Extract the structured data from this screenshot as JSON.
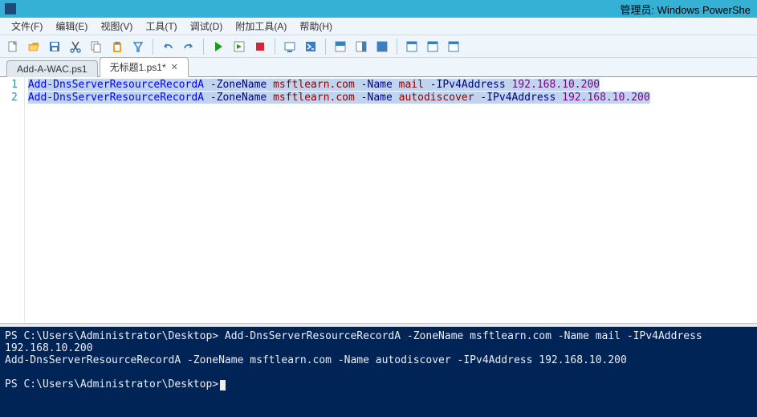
{
  "titlebar": {
    "title": "管理员: Windows PowerShe"
  },
  "menubar": {
    "items": [
      {
        "label": "文件(F)"
      },
      {
        "label": "编辑(E)"
      },
      {
        "label": "视图(V)"
      },
      {
        "label": "工具(T)"
      },
      {
        "label": "调试(D)"
      },
      {
        "label": "附加工具(A)"
      },
      {
        "label": "帮助(H)"
      }
    ]
  },
  "tabs": [
    {
      "label": "Add-A-WAC.ps1",
      "active": false,
      "closable": false
    },
    {
      "label": "无标题1.ps1*",
      "active": true,
      "closable": true
    }
  ],
  "editor": {
    "lines": [
      {
        "num": "1",
        "tokens": [
          {
            "t": "Add-DnsServerResourceRecordA",
            "cls": "tk-cmd"
          },
          {
            "t": " ",
            "cls": "tk-plain"
          },
          {
            "t": "-ZoneName",
            "cls": "tk-param"
          },
          {
            "t": " ",
            "cls": "tk-plain"
          },
          {
            "t": "msftlearn.com",
            "cls": "tk-str"
          },
          {
            "t": " ",
            "cls": "tk-plain"
          },
          {
            "t": "-Name",
            "cls": "tk-param"
          },
          {
            "t": " ",
            "cls": "tk-plain"
          },
          {
            "t": "mail",
            "cls": "tk-str"
          },
          {
            "t": " ",
            "cls": "tk-plain"
          },
          {
            "t": "-IPv4Address",
            "cls": "tk-param"
          },
          {
            "t": " ",
            "cls": "tk-plain"
          },
          {
            "t": "192.168.10.200",
            "cls": "tk-ip"
          }
        ]
      },
      {
        "num": "2",
        "tokens": [
          {
            "t": "Add-DnsServerResourceRecordA",
            "cls": "tk-cmd"
          },
          {
            "t": " ",
            "cls": "tk-plain"
          },
          {
            "t": "-ZoneName",
            "cls": "tk-param"
          },
          {
            "t": " ",
            "cls": "tk-plain"
          },
          {
            "t": "msftlearn.com",
            "cls": "tk-str"
          },
          {
            "t": " ",
            "cls": "tk-plain"
          },
          {
            "t": "-Name",
            "cls": "tk-param"
          },
          {
            "t": " ",
            "cls": "tk-plain"
          },
          {
            "t": "autodiscover",
            "cls": "tk-str"
          },
          {
            "t": " ",
            "cls": "tk-plain"
          },
          {
            "t": "-IPv4Address",
            "cls": "tk-param"
          },
          {
            "t": " ",
            "cls": "tk-plain"
          },
          {
            "t": "192.168.10.200",
            "cls": "tk-ip"
          }
        ]
      }
    ]
  },
  "console": {
    "lines": [
      "PS C:\\Users\\Administrator\\Desktop> Add-DnsServerResourceRecordA -ZoneName msftlearn.com -Name mail -IPv4Address 192.168.10.200",
      "Add-DnsServerResourceRecordA -ZoneName msftlearn.com -Name autodiscover -IPv4Address 192.168.10.200",
      "",
      "PS C:\\Users\\Administrator\\Desktop>"
    ]
  },
  "toolbar_icons": [
    "new-file-icon",
    "open-file-icon",
    "save-icon",
    "cut-icon",
    "copy-icon",
    "paste-icon",
    "clear-icon",
    "sep",
    "undo-icon",
    "redo-icon",
    "sep",
    "run-icon",
    "run-selection-icon",
    "stop-icon",
    "sep",
    "remote-icon",
    "powershell-icon",
    "sep",
    "pane-top-icon",
    "pane-right-icon",
    "pane-max-icon",
    "sep",
    "command-addon-icon",
    "script-pane-icon",
    "cmd-window-icon"
  ]
}
